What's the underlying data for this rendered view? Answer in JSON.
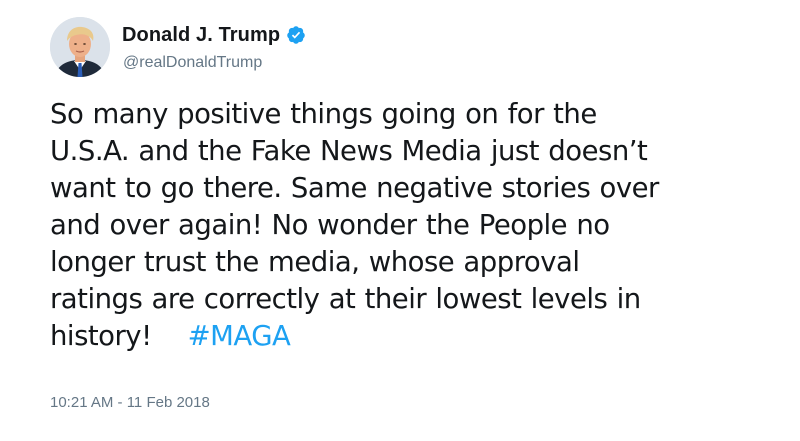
{
  "author": {
    "display_name": "Donald J. Trump",
    "handle": "@realDonaldTrump",
    "verified": true,
    "verified_icon": "verified-badge-icon"
  },
  "tweet": {
    "lines": [
      "So many positive things going on for the",
      "U.S.A. and the Fake News Media just doesn’t",
      "want to go there. Same negative stories over",
      "and over again! No wonder the People no",
      "longer trust the media, whose approval",
      "ratings are correctly at their lowest levels in",
      "history!"
    ],
    "hashtag": "#MAGA",
    "timestamp": "10:21 AM - 11 Feb 2018"
  },
  "colors": {
    "text": "#14171a",
    "secondary": "#657786",
    "link": "#1da1f2",
    "verified": "#1da1f2"
  }
}
